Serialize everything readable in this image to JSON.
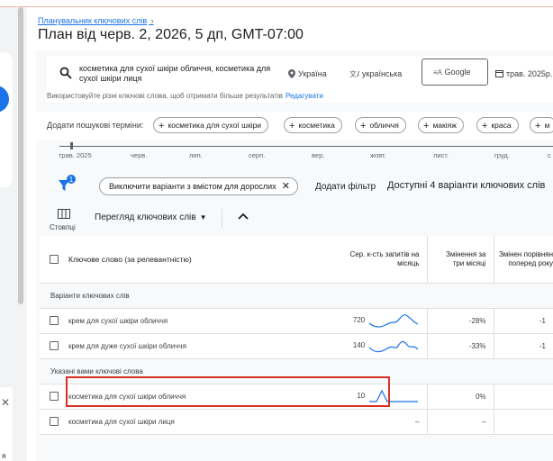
{
  "breadcrumb": {
    "label": "Планувальник ключових слів"
  },
  "page": {
    "title": "План від черв. 2, 2026, 5 дп, GMT-07:00"
  },
  "search": {
    "keywords": "косметика для сухої шкіри обличчя, косметика для сухої шкіри лиця",
    "location": "Україна",
    "language": "українська",
    "network": "Google",
    "date": "трав. 2025р.",
    "hint": "Використовуйте різні ключові слова, щоб отримати більше результатів",
    "hint_link": "Редагувати"
  },
  "add_terms": {
    "label": "Додати пошукові терміни:",
    "chips": [
      "косметика для сухої шкіри",
      "косметика",
      "обличчя",
      "макіяж",
      "краса",
      "м"
    ]
  },
  "timeline": {
    "labels": [
      "трав. 2025",
      "черв.",
      "лип.",
      "серп.",
      "вер.",
      "жовт.",
      "лист.",
      "груд.",
      "с"
    ]
  },
  "filters": {
    "badge": "1",
    "adult_chip": "Виключити варіанти з вмістом для дорослих",
    "add_filter": "Додати фільтр",
    "available": "Доступні 4 варіанти ключових слів"
  },
  "toolbar": {
    "columns": "Стовпці",
    "view": "Перегляд ключових слів"
  },
  "table": {
    "headers": {
      "keyword": "Ключове слово (за релевантністю)",
      "avg": "Сер. к-сть запитів на місяць",
      "three_month": "Змінення за три місяці",
      "yoy": "Змінен порівнян поперед року"
    },
    "sections": [
      {
        "title": "Варіанти ключових слів",
        "rows": [
          {
            "keyword": "крем для сухої шкіри обличчя",
            "avg": "720",
            "three_month": "-28%",
            "yoy": "-1"
          },
          {
            "keyword": "крем для дуже сухої шкіри обличчя",
            "avg": "140",
            "three_month": "-33%",
            "yoy": "-1"
          }
        ]
      },
      {
        "title": "Указані вами ключові слова",
        "rows": [
          {
            "keyword": "косметика для сухої шкіри обличчя",
            "avg": "10",
            "three_month": "0%",
            "yoy": ""
          },
          {
            "keyword": "косметика для сухої шкіри лиця",
            "avg": "–",
            "three_month": "–",
            "yoy": ""
          }
        ]
      }
    ]
  },
  "left_panel": {
    "bottom_text": "я"
  },
  "colors": {
    "accent": "#1a73e8",
    "highlight": "#d93025",
    "spark": "#1a73e8"
  }
}
